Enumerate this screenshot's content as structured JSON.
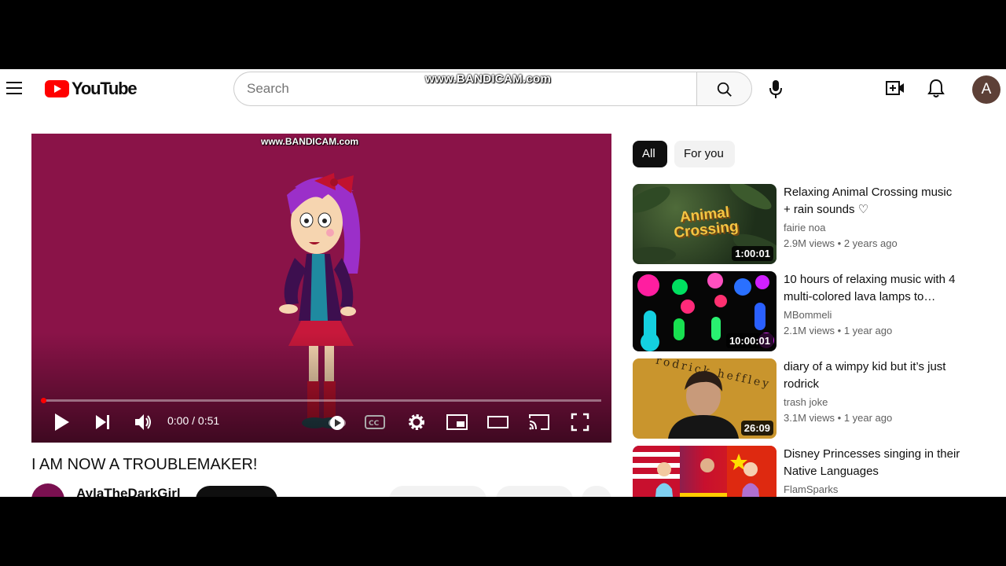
{
  "header": {
    "logo_text": "YouTube",
    "search_placeholder": "Search",
    "watermark": "www.BANDICAM.com",
    "avatar_letter": "A"
  },
  "player": {
    "watermark": "www.BANDICAM.com",
    "time": "0:00 / 0:51",
    "progress": 0.0,
    "background_color": "#8a1348"
  },
  "video": {
    "title": "I AM NOW A TROUBLEMAKER!",
    "channel": "AylaTheDarkGirl"
  },
  "chips": [
    {
      "label": "All",
      "active": true
    },
    {
      "label": "For you",
      "active": false
    }
  ],
  "recommendations": [
    {
      "title": "Relaxing Animal Crossing music + rain sounds ♡",
      "channel": "fairie noa",
      "views": "2.9M views",
      "age": "2 years ago",
      "duration": "1:00:01",
      "thumb_text": "Animal Crossing"
    },
    {
      "title": "10 hours of relaxing music with 4 multi-colored lava lamps to…",
      "channel": "MBommeli",
      "views": "2.1M views",
      "age": "1 year ago",
      "duration": "10:00:01"
    },
    {
      "title": "diary of a wimpy kid but it’s just rodrick",
      "channel": "trash joke",
      "views": "3.1M views",
      "age": "1 year ago",
      "duration": "26:09",
      "thumb_text": "rodrick heffley"
    },
    {
      "title": "Disney Princesses singing in their Native Languages",
      "channel": "FlamSparks",
      "views": "",
      "age": "",
      "duration": ""
    }
  ]
}
